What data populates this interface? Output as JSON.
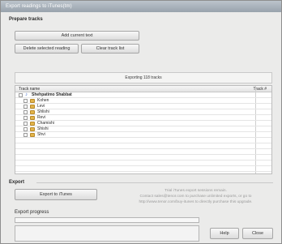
{
  "window": {
    "title": "Export readings to iTunes(tm)"
  },
  "prepare": {
    "label": "Prepare tracks",
    "add_current": "Add current text",
    "delete_selected": "Delete selected reading",
    "clear_list": "Clear track list"
  },
  "status": "Exporting 118 tracks",
  "table": {
    "col_name": "Track name",
    "col_num": "Track #",
    "parent": "Shehpatimo Shabbat",
    "items": [
      "Kohen",
      "Levi",
      "Shlishi",
      "Revi",
      "Chamishi",
      "Shishi",
      "Shvi"
    ]
  },
  "export": {
    "label": "Export",
    "export_button": "Export to iTunes",
    "promo": [
      "Trial iTunes export sessions remain.",
      "Contact sales@tenor.com to purchase unlimited exports, or go to",
      "http://www.tenor.com/buy-itunes to directly purchase this upgrade."
    ]
  },
  "progress": {
    "label": "Export progress",
    "value": 0
  },
  "footer": {
    "help": "Help",
    "close": "Close"
  }
}
